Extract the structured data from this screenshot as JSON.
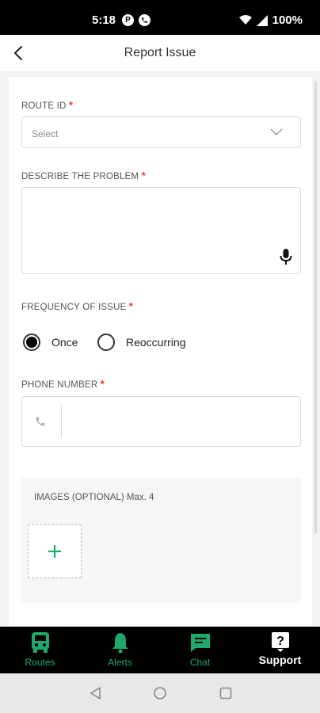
{
  "status_bar": {
    "time": "5:18",
    "app_icon_1": "P",
    "app_icon_2": "phone",
    "battery": "100%"
  },
  "header": {
    "title": "Report Issue",
    "back_icon": "chevron-left-icon"
  },
  "form": {
    "route_id": {
      "label": "ROUTE ID",
      "required_mark": "*",
      "placeholder": "Select"
    },
    "problem": {
      "label": "DESCRIBE THE PROBLEM",
      "required_mark": "*",
      "value": ""
    },
    "frequency": {
      "label": "FREQUENCY OF ISSUE",
      "required_mark": "*",
      "options": [
        {
          "label": "Once",
          "selected": true
        },
        {
          "label": "Reoccurring",
          "selected": false
        }
      ]
    },
    "phone": {
      "label": "PHONE NUMBER",
      "required_mark": "*",
      "value": ""
    },
    "images": {
      "label": "IMAGES (OPTIONAL) Max. 4",
      "add_icon": "plus-icon"
    }
  },
  "bottom_nav": {
    "items": [
      {
        "label": "Routes",
        "icon": "bus-icon",
        "active": false
      },
      {
        "label": "Alerts",
        "icon": "bell-icon",
        "active": false
      },
      {
        "label": "Chat",
        "icon": "chat-icon",
        "active": false
      },
      {
        "label": "Support",
        "icon": "help-icon",
        "active": true
      }
    ]
  },
  "colors": {
    "accent": "#1fa86b",
    "required": "#e53935",
    "nav_bg": "#000000"
  }
}
